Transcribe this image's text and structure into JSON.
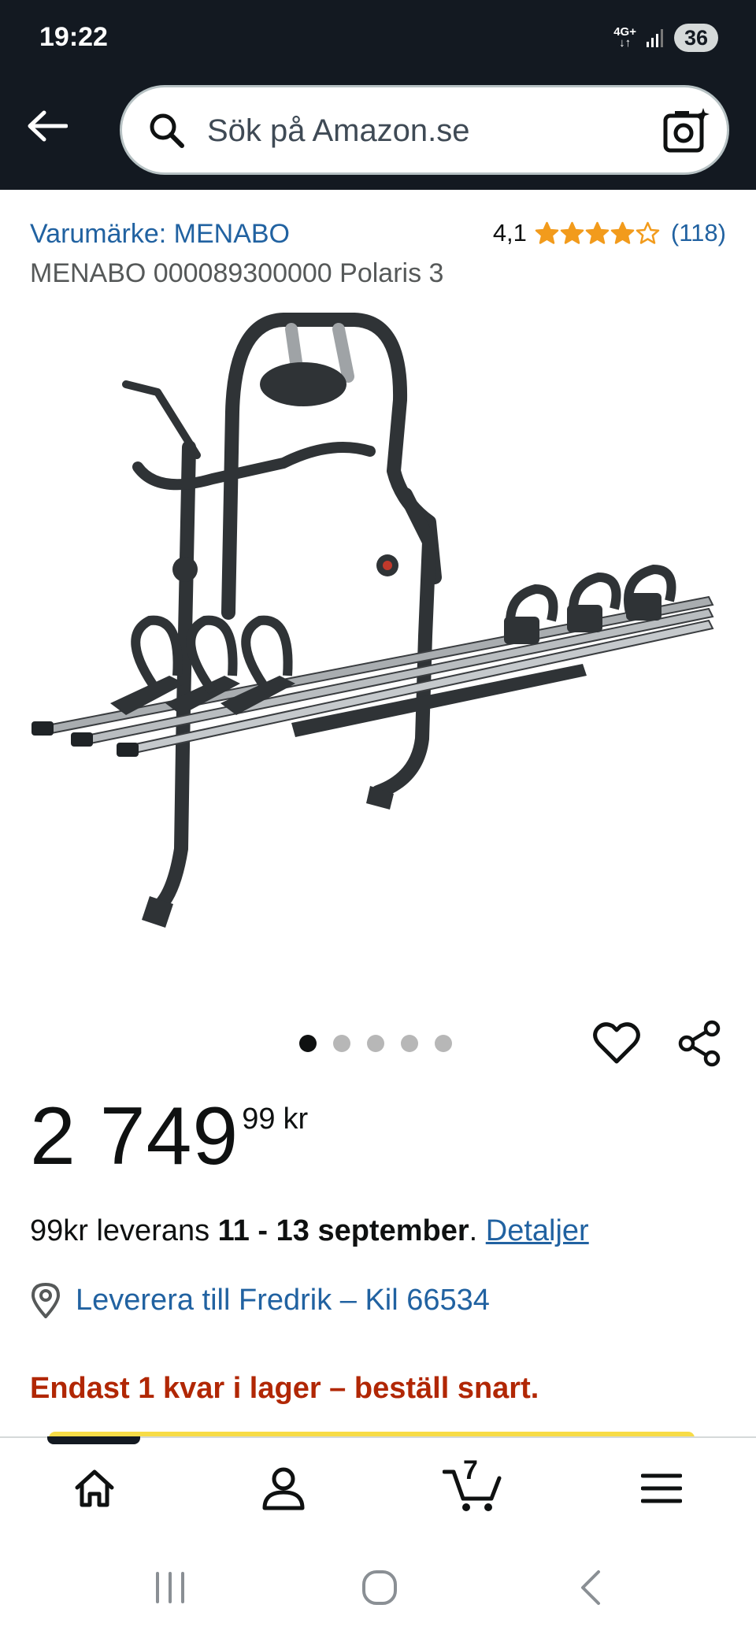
{
  "status_bar": {
    "time": "19:22",
    "network_label_top": "4G+",
    "network_label_bottom": "↓↑",
    "battery": "36"
  },
  "header": {
    "back_icon": "arrow-left-icon",
    "search_placeholder": "Sök på Amazon.se",
    "search_icon": "search-icon",
    "camera_icon": "camera-icon"
  },
  "product": {
    "brand_link": "Varumärke: MENABO",
    "rating_value": "4,1",
    "rating_stars": 4.1,
    "rating_count": "(118)",
    "title": "MENABO 000089300000 Polaris 3",
    "image_count": 5,
    "active_image": 0
  },
  "price": {
    "whole": "2 749",
    "fraction": "99",
    "currency": "kr"
  },
  "delivery": {
    "prefix": "99kr leverans ",
    "dates": "11 - 13 september",
    "suffix": ". ",
    "details_link": "Detaljer"
  },
  "location": {
    "icon": "location-pin-icon",
    "text": "Leverera till Fredrik – Kil 66534"
  },
  "stock": {
    "message": "Endast 1 kvar i lager – beställ snart."
  },
  "bottom_nav": {
    "items": [
      {
        "name": "home",
        "icon": "home-icon"
      },
      {
        "name": "account",
        "icon": "user-icon"
      },
      {
        "name": "cart",
        "icon": "cart-icon",
        "badge": "7"
      },
      {
        "name": "menu",
        "icon": "hamburger-menu-icon"
      }
    ],
    "active_index": 0
  },
  "colors": {
    "header_bg": "#131921",
    "link": "#2162a1",
    "star": "#f29b1c",
    "stock_warning": "#b12704",
    "buy_button": "#f7dc47"
  }
}
